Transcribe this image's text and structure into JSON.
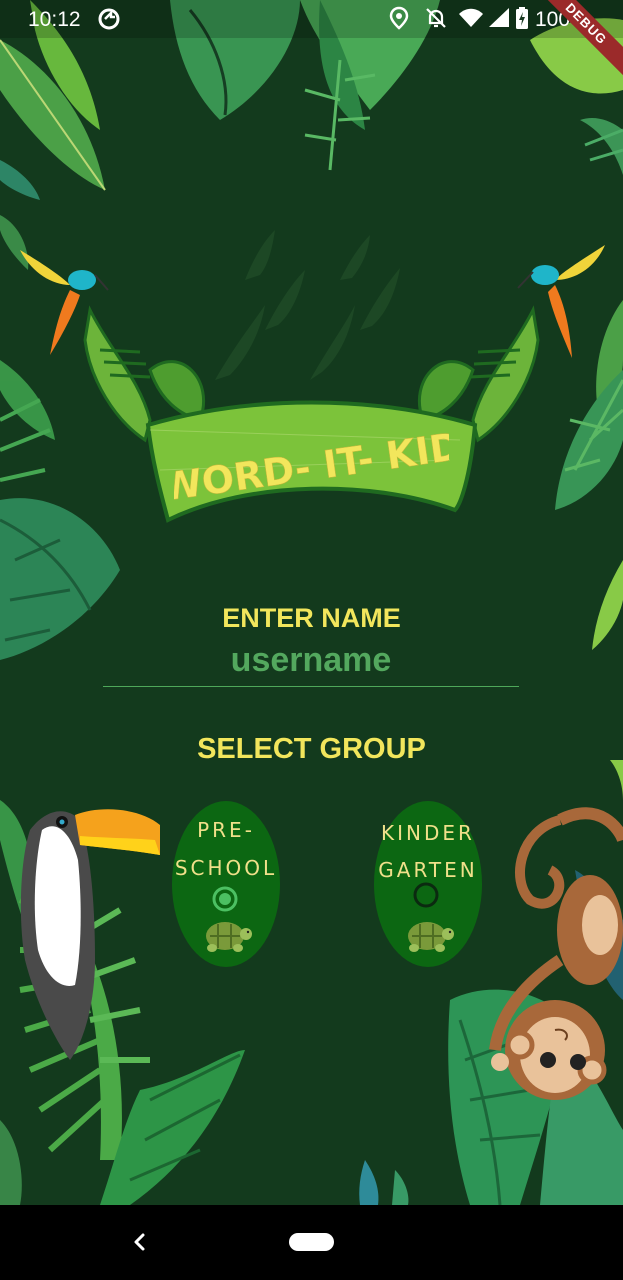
{
  "status_bar": {
    "time": "10:12",
    "battery": "100%",
    "icons": [
      "sync-icon",
      "location-icon",
      "notifications-off-icon",
      "wifi-icon",
      "signal-icon",
      "battery-icon"
    ]
  },
  "debug_banner": "DEBUG",
  "logo": {
    "text": "WORD- IT- KID"
  },
  "name_section": {
    "label": "ENTER NAME",
    "input_placeholder": "username",
    "input_value": ""
  },
  "group_section": {
    "label": "SELECT GROUP",
    "options": [
      {
        "line1": "PRE-",
        "line2": "SCHOOL",
        "selected": true,
        "icon": "turtle-icon"
      },
      {
        "line1": "KINDER",
        "line2": "GARTEN",
        "selected": false,
        "icon": "turtle-icon"
      }
    ]
  },
  "nav_bar": {
    "icons": [
      "back-icon",
      "home-pill-icon"
    ]
  },
  "colors": {
    "background": "#133a1d",
    "label_yellow": "#f2e65c",
    "input_green": "#53a85e",
    "option_bg": "#0c6712",
    "option_text": "#f0e08a",
    "banner_green": "#7cc33a"
  }
}
